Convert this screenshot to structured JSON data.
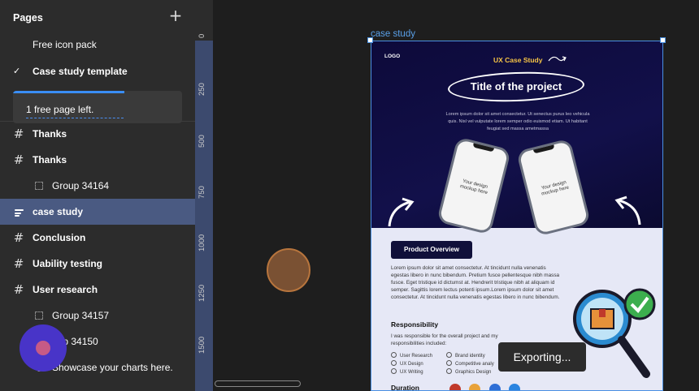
{
  "sidebar": {
    "pages_title": "Pages",
    "pages": [
      {
        "label": "Free icon pack",
        "selected": false
      },
      {
        "label": "Case study template",
        "selected": true
      }
    ],
    "notice": {
      "text": "1 free page left.",
      "progress": 0.66
    },
    "layers": [
      {
        "label": "Thanks",
        "icon": "frame-icon"
      },
      {
        "label": "Thanks",
        "icon": "frame-icon"
      },
      {
        "label": "Group 34164",
        "icon": "group-icon"
      },
      {
        "label": "case study",
        "icon": "section-icon"
      },
      {
        "label": "Conclusion",
        "icon": "frame-icon"
      },
      {
        "label": "Uability testing",
        "icon": "frame-icon"
      },
      {
        "label": "User research",
        "icon": "frame-icon"
      },
      {
        "label": "Group 34157",
        "icon": "group-icon"
      },
      {
        "label": "oup 34150",
        "icon": "group-icon"
      },
      {
        "label": "Showcase your charts here.",
        "icon": "text-icon"
      }
    ]
  },
  "ruler": {
    "ticks": [
      "0",
      "250",
      "500",
      "750",
      "1000",
      "1250",
      "1500"
    ]
  },
  "canvas": {
    "frame_label": "case study",
    "frame": {
      "logo": "LOGO",
      "tag": "UX Case Study",
      "title": "Title of the project",
      "hero_text": "Lorem ipsum dolor sit amet consectetur. Ut senectus purus leo vehicula quis. Nisl vel vulputate lorem semper odio euismod etiam. Ut habitant feugiat sed massa ametmassa",
      "phone_text": "Your design mockup here",
      "overview_button": "Product Overview",
      "overview_text": "Lorem ipsum dolor sit amet consectetur. At tincidunt nulla venenatis egestas libero in nunc bibendum. Pretium fusce pellentesque nibh massa fusce. Eget tristique id dictumst at. Hendrerit tristique nibh at aliquam id semper. Sagittis lorem lectus potenti ipsum.Lorem ipsum dolor sit amet consectetur. At tincidunt nulla venenatis egestas libero in nunc bibendum.",
      "responsibility_title": "Responsibility",
      "responsibility_text": "I was responsible for the overall project and my responsibilities included:",
      "options": [
        "User Research",
        "Brand identity",
        "UX Design",
        "Competitive analy",
        "UX Writing",
        "Graphics Design"
      ],
      "duration_title": "Duration"
    },
    "toast": "Exporting..."
  }
}
